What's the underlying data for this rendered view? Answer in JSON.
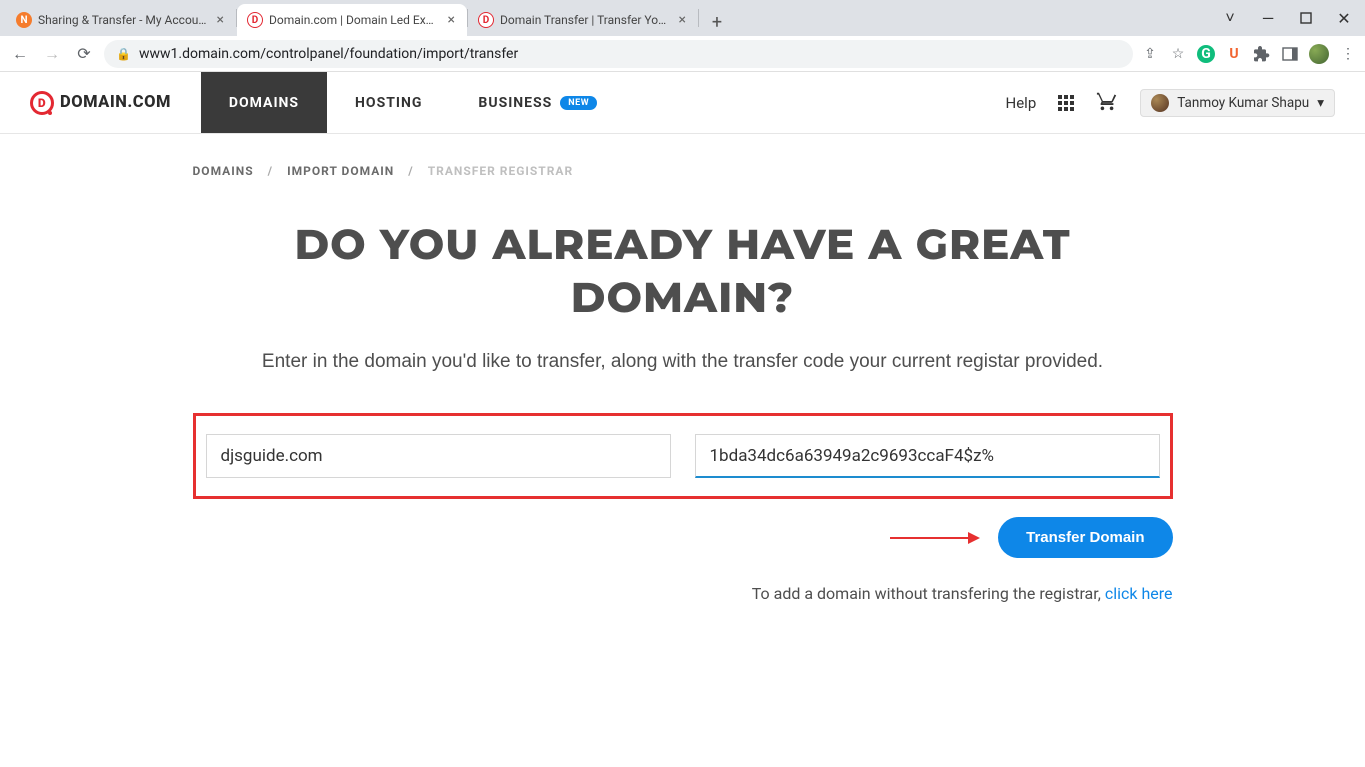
{
  "browser": {
    "tabs": [
      {
        "title": "Sharing & Transfer - My Account",
        "favicon_bg": "#f57c2d",
        "favicon_letter": "N"
      },
      {
        "title": "Domain.com | Domain Led Exper",
        "favicon_bg": "#ffffff",
        "favicon_letter": "D",
        "favicon_fg": "#e32832",
        "favicon_border": "#e32832",
        "active": true
      },
      {
        "title": "Domain Transfer | Transfer Your D",
        "favicon_bg": "#ffffff",
        "favicon_letter": "D",
        "favicon_fg": "#e32832",
        "favicon_border": "#e32832"
      }
    ],
    "url": "www1.domain.com/controlpanel/foundation/import/transfer"
  },
  "header": {
    "logo_text": "DOMAIN.COM",
    "nav": [
      {
        "label": "DOMAINS",
        "active": true
      },
      {
        "label": "HOSTING"
      },
      {
        "label": "BUSINESS",
        "badge": "NEW"
      }
    ],
    "help": "Help",
    "user": "Tanmoy Kumar Shapu"
  },
  "breadcrumb": {
    "items": [
      "DOMAINS",
      "IMPORT DOMAIN",
      "TRANSFER REGISTRAR"
    ]
  },
  "hero": "DO YOU ALREADY HAVE A GREAT DOMAIN?",
  "subhead": "Enter in the domain you'd like to transfer, along with the transfer code your current registar provided.",
  "form": {
    "domain_value": "djsguide.com",
    "code_value": "1bda34dc6a63949a2c9693ccaF4$z%",
    "submit_label": "Transfer Domain"
  },
  "helper": {
    "text": "To add a domain without transfering the registrar, ",
    "link": "click here"
  }
}
